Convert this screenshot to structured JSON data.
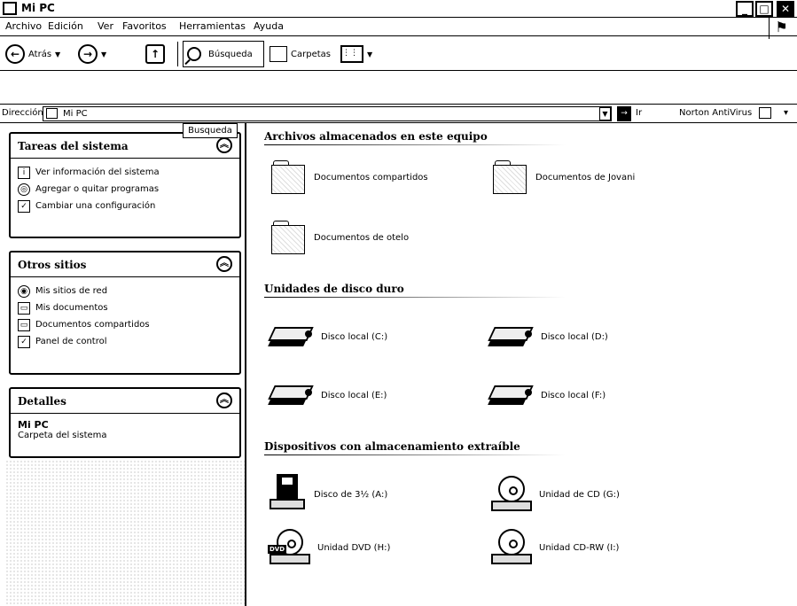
{
  "window": {
    "title": "Mi PC"
  },
  "menu": [
    "Archivo",
    "Edición",
    "Ver",
    "Favoritos",
    "Herramientas",
    "Ayuda"
  ],
  "toolbar": {
    "back_label": "Atrás",
    "search_label": "Búsqueda",
    "folders_label": "Carpetas"
  },
  "address": {
    "label": "Dirección",
    "value": "Mi PC",
    "go_label": "Ir",
    "norton_label": "Norton AntiVirus"
  },
  "tooltip": "Busqueda",
  "sidebar": {
    "tasks": {
      "title": "Tareas del sistema",
      "items": [
        {
          "label": "Ver información del sistema",
          "icon": "info-icon"
        },
        {
          "label": "Agregar o quitar programas",
          "icon": "programs-icon"
        },
        {
          "label": "Cambiar una configuración",
          "icon": "settings-icon"
        }
      ]
    },
    "places": {
      "title": "Otros sitios",
      "items": [
        {
          "label": "Mis sitios de red",
          "icon": "network-icon"
        },
        {
          "label": "Mis documentos",
          "icon": "documents-icon"
        },
        {
          "label": "Documentos compartidos",
          "icon": "shared-folder-icon"
        },
        {
          "label": "Panel de control",
          "icon": "control-panel-icon"
        }
      ]
    },
    "details": {
      "title": "Detalles",
      "name": "Mi PC",
      "type": "Carpeta del sistema"
    }
  },
  "content": {
    "stored": {
      "title": "Archivos almacenados en este equipo",
      "items": [
        "Documentos compartidos",
        "Documentos de Jovani",
        "Documentos de otelo"
      ]
    },
    "disks": {
      "title": "Unidades de disco duro",
      "items": [
        "Disco local (C:)",
        "Disco local (D:)",
        "Disco local (E:)",
        "Disco local (F:)"
      ]
    },
    "removable": {
      "title": "Dispositivos con almacenamiento extraíble",
      "items": [
        "Disco de 3½ (A:)",
        "Unidad de CD (G:)",
        "Unidad DVD (H:)",
        "Unidad CD-RW (I:)"
      ],
      "dvd_badge": "DVD"
    }
  }
}
